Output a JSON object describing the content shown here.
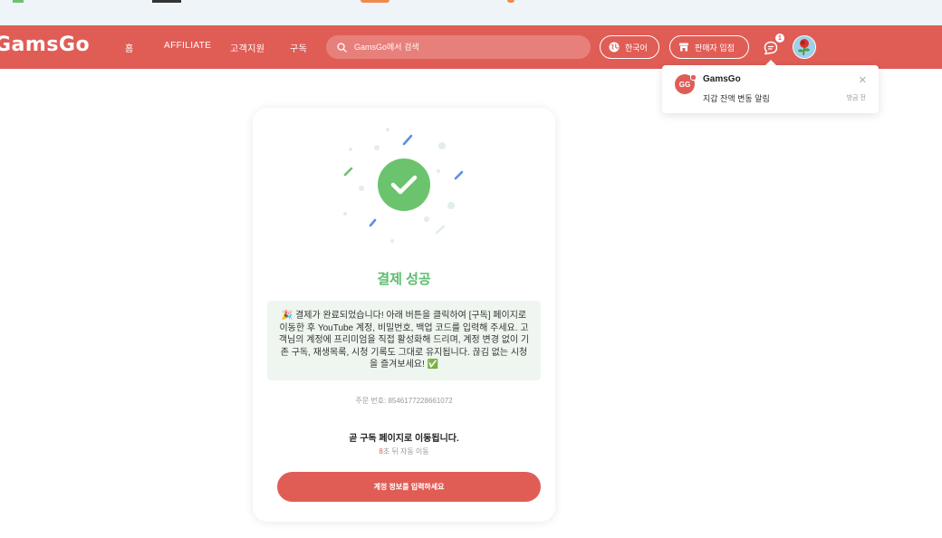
{
  "navbar": {
    "logo": "GamsGo",
    "links": [
      "홈",
      "AFFILIATE",
      "고객지원",
      "구독"
    ],
    "search_placeholder": "GamsGo에서 검색",
    "language_label": "한국어",
    "seller_label": "판매자 입점",
    "chat_badge": "1"
  },
  "notification": {
    "title": "GamsGo",
    "logo_text": "GG",
    "message": "지갑 잔액 변동 알림",
    "time": "방금 전"
  },
  "card": {
    "title": "결제 성공",
    "message": "🎉 결제가 완료되었습니다! 아래 버튼을 클릭하여 [구독] 페이지로 이동한 후 YouTube 계정, 비밀번호, 백업 코드를 입력해 주세요. 고객님의 계정에 프리미엄을 직접 활성화해 드리며, 계정 변경 없이 기존 구독, 재생목록, 시청 기록도 그대로 유지됩니다. 끊김 없는 시청을 즐겨보세요! ✅",
    "order_label": "주문 번호: 8546177228661072",
    "redirect_text": "곧 구독 페이지로 이동됩니다.",
    "countdown_number": "8",
    "countdown_suffix": "초 뒤 자동 이동",
    "cta_label": "계정 정보를 입력하세요"
  },
  "colors": {
    "brand": "#e05d56",
    "success": "#5cbd6e",
    "message_bg": "#eef6ef"
  }
}
